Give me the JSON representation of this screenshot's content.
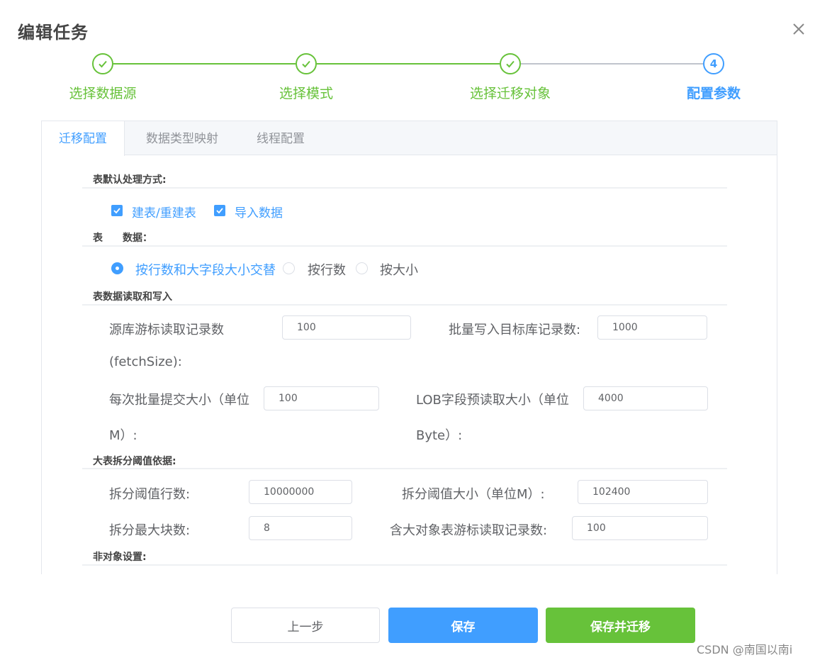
{
  "dialog": {
    "title": "编辑任务"
  },
  "steps": [
    {
      "label": "选择数据源",
      "status": "done"
    },
    {
      "label": "选择模式",
      "status": "done"
    },
    {
      "label": "选择迁移对象",
      "status": "done"
    },
    {
      "label": "配置参数",
      "status": "active",
      "number": "4"
    }
  ],
  "tabs": [
    {
      "label": "迁移配置",
      "active": true
    },
    {
      "label": "数据类型映射",
      "active": false
    },
    {
      "label": "线程配置",
      "active": false
    }
  ],
  "sections": {
    "table_default": "表默认处理方式:",
    "table_split": "表　　数据：",
    "data_rw": "表数据读取和写入",
    "big_table": "大表拆分阈值依据:",
    "non_object": "非对象设置:"
  },
  "checkboxes": [
    {
      "label": "建表/重建表",
      "checked": true
    },
    {
      "label": "导入数据",
      "checked": true
    }
  ],
  "radios": [
    {
      "label": "按行数和大字段大小交替",
      "checked": true
    },
    {
      "label": "按行数",
      "checked": false
    },
    {
      "label": "按大小",
      "checked": false
    }
  ],
  "fields": {
    "fetch_size": {
      "label_line1": "源库游标读取记录数",
      "label_line2": "(fetchSize):",
      "value": "100"
    },
    "batch_write": {
      "label": "批量写入目标库记录数:",
      "value": "1000"
    },
    "batch_commit": {
      "label_line1": "每次批量提交大小（单位",
      "label_line2": "M）:",
      "value": "100"
    },
    "lob_prefetch": {
      "label_line1": "LOB字段预读取大小（单位",
      "label_line2": "Byte）:",
      "value": "4000"
    },
    "split_rows": {
      "label": "拆分阈值行数:",
      "value": "10000000"
    },
    "split_size": {
      "label": "拆分阈值大小（单位M）:",
      "value": "102400"
    },
    "split_max_blocks": {
      "label": "拆分最大块数:",
      "value": "8"
    },
    "lob_table_fetch": {
      "label": "含大对象表游标读取记录数:",
      "value": "100"
    }
  },
  "buttons": {
    "prev": "上一步",
    "save": "保存",
    "save_migrate": "保存并迁移"
  },
  "watermark": "CSDN @南国以南i",
  "colors": {
    "primary": "#409eff",
    "success": "#67c23a",
    "border": "#dcdfe6",
    "text": "#606266"
  }
}
